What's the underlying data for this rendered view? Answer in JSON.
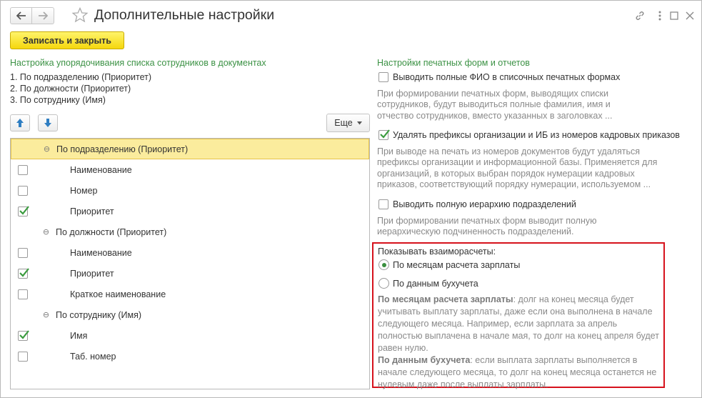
{
  "window": {
    "title": "Дополнительные настройки",
    "icons": [
      "arrow-left-icon",
      "arrow-right-icon",
      "star-icon",
      "link-icon",
      "more-vertical-icon",
      "maximize-icon",
      "close-icon"
    ]
  },
  "toolbar": {
    "save_label": "Записать и закрыть",
    "accent": "#f5d70d"
  },
  "left": {
    "section_title": "Настройка упорядочивания списка сотрудников в документах",
    "order_lines": [
      "1. По подразделению (Приоритет)",
      "2. По должности (Приоритет)",
      "3. По сотруднику (Имя)"
    ],
    "more_label": "Еще",
    "tree": [
      {
        "type": "group",
        "label": "По подразделению (Приоритет)",
        "selected": true
      },
      {
        "type": "field",
        "label": "Наименование",
        "checked": false
      },
      {
        "type": "field",
        "label": "Номер",
        "checked": false
      },
      {
        "type": "field",
        "label": "Приоритет",
        "checked": true
      },
      {
        "type": "group",
        "label": "По должности (Приоритет)",
        "selected": false
      },
      {
        "type": "field",
        "label": "Наименование",
        "checked": false
      },
      {
        "type": "field",
        "label": "Приоритет",
        "checked": true
      },
      {
        "type": "field",
        "label": "Краткое наименование",
        "checked": false
      },
      {
        "type": "group",
        "label": "По сотруднику (Имя)",
        "selected": false
      },
      {
        "type": "field",
        "label": "Имя",
        "checked": true
      },
      {
        "type": "field",
        "label": "Таб. номер",
        "checked": false
      }
    ]
  },
  "right": {
    "section_title": "Настройки печатных форм и отчетов",
    "opt1": {
      "label": "Выводить полные ФИО в списочных печатных формах",
      "checked": false,
      "hint": [
        "При формировании печатных форм, выводящих списки",
        "сотрудников, будут выводиться полные фамилия, имя и",
        "отчество сотрудников, вместо указанных в заголовках ..."
      ]
    },
    "opt2": {
      "label": "Удалять префиксы организации и ИБ из номеров кадровых приказов",
      "checked": true,
      "hint": [
        "При выводе на печать из номеров документов будут удаляться",
        "префиксы организации и информационной базы. Применяется для",
        "организаций, в которых выбран порядок нумерации кадровых",
        "приказов, соответствующий порядку нумерации, используемом ..."
      ]
    },
    "opt3": {
      "label": "Выводить полную иерархию подразделений",
      "checked": false,
      "hint": [
        "При формировании печатных форм выводит полную",
        "иерархическую подчиненность подразделений."
      ]
    },
    "settlements": {
      "title": "Показывать взаиморасчеты:",
      "radio1": "По месяцам расчета зарплаты",
      "radio2": "По данным бухучета",
      "selected": 1,
      "explain1_bold": "По месяцам расчета зарплаты",
      "explain1_text": ": долг на конец месяца будет учитывать выплату зарплаты, даже если она выполнена в начале следующего месяца. Например, если зарплата за апрель полностью выплачена в начале мая, то долг на конец апреля будет равен нулю.",
      "explain2_bold": "По данным бухучета",
      "explain2_text": ": если выплата зарплаты выполняется в начале следующего месяца, то долг на конец месяца останется не нулевым даже после выплаты зарплаты.",
      "highlight_color": "#d6121c"
    }
  }
}
